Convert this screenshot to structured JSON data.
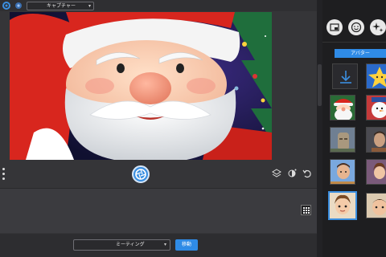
{
  "toolbar": {
    "camera_select_label": "キャプチャー"
  },
  "bottom": {
    "meeting_select_label": "ミーティング",
    "move_button_label": "移動"
  },
  "sidebar": {
    "tab_label": "アバター",
    "icons": [
      "picture-in-picture-icon",
      "smiley-icon",
      "effects-sparkle-icon"
    ]
  },
  "colors": {
    "accent": "#2f8be6",
    "background": "#2b2b2e"
  }
}
